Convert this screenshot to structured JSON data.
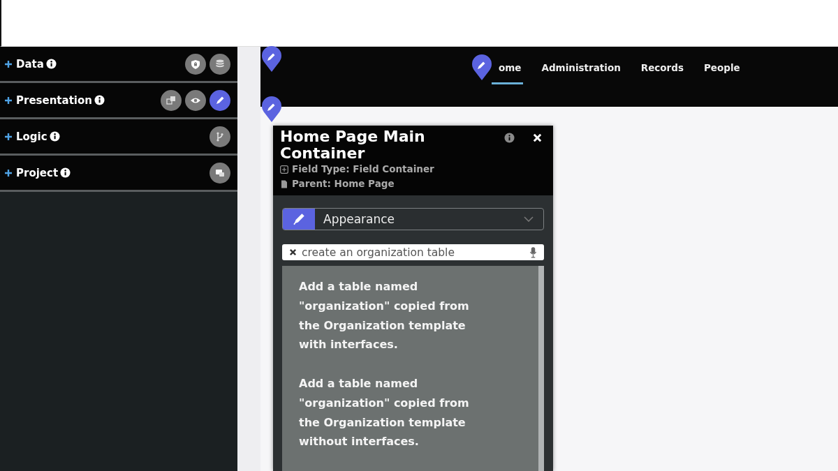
{
  "sidebar": {
    "sections": [
      {
        "label": "Data",
        "tools": [
          {
            "kind": "shield",
            "selected": false
          },
          {
            "kind": "database",
            "selected": false
          }
        ]
      },
      {
        "label": "Presentation",
        "tools": [
          {
            "kind": "layers",
            "selected": false
          },
          {
            "kind": "eye",
            "selected": false
          },
          {
            "kind": "pen",
            "selected": true
          }
        ]
      },
      {
        "label": "Logic",
        "tools": [
          {
            "kind": "branch",
            "selected": false
          }
        ]
      },
      {
        "label": "Project",
        "tools": [
          {
            "kind": "chat",
            "selected": false
          }
        ]
      }
    ]
  },
  "nav": {
    "items": [
      {
        "label": "ome",
        "selected": true
      },
      {
        "label": "Administration",
        "selected": false
      },
      {
        "label": "Records",
        "selected": false
      },
      {
        "label": "People",
        "selected": false
      }
    ]
  },
  "panel": {
    "title": "Home Page Main Container",
    "field_type": "Field Type: Field Container",
    "parent": "Parent: Home Page",
    "category": "Appearance",
    "search": {
      "value": "create an organization table"
    },
    "suggestions": [
      "Add a table named \"organization\" copied from the Organization template with interfaces.",
      "Add a table named \"organization\" copied from the Organization template without interfaces."
    ]
  }
}
